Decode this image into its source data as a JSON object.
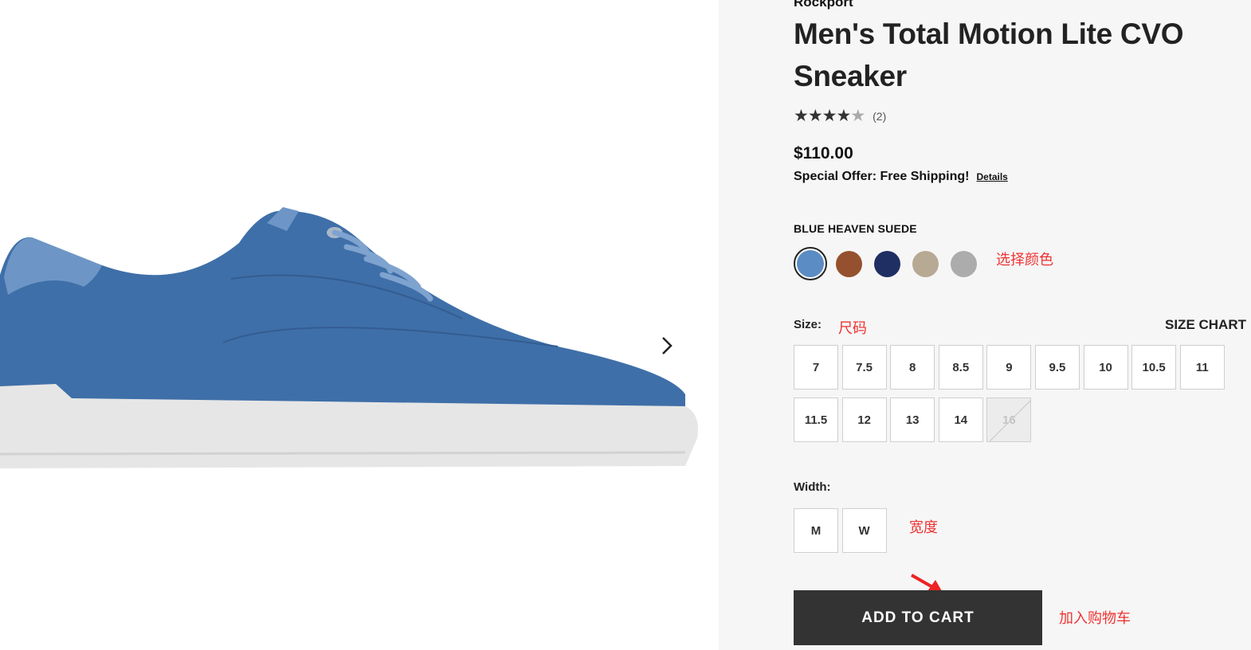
{
  "product": {
    "brand": "Rockport",
    "title": "Men's Total Motion Lite CVO Sneaker",
    "rating_stars": "★★★★",
    "rating_half": "★",
    "review_count": "(2)",
    "price": "$110.00",
    "offer_text": "Special Offer: Free Shipping!",
    "offer_details": "Details"
  },
  "color": {
    "label": "BLUE HEAVEN SUEDE",
    "swatches": [
      "#5b8cc4",
      "#95502f",
      "#1f2f63",
      "#b7a993",
      "#acacac"
    ],
    "annotation": "选择颜色"
  },
  "size": {
    "label": "Size:",
    "annotation": "尺码",
    "chart": "SIZE CHART",
    "options": [
      "7",
      "7.5",
      "8",
      "8.5",
      "9",
      "9.5",
      "10",
      "10.5",
      "11",
      "11.5",
      "12",
      "13",
      "14",
      "16"
    ],
    "unavailable": [
      "16"
    ]
  },
  "width": {
    "label": "Width:",
    "annotation": "宽度",
    "options": [
      "M",
      "W"
    ]
  },
  "cart": {
    "label": "ADD TO CART",
    "annotation": "加入购物车"
  },
  "icons": {
    "gallery_next": "chevron-right-icon",
    "annotation_arrow": "red-arrow-icon"
  },
  "colors": {
    "accent_annotation": "#ee3333",
    "button_bg": "#333333",
    "panel_bg": "#f6f6f6"
  }
}
